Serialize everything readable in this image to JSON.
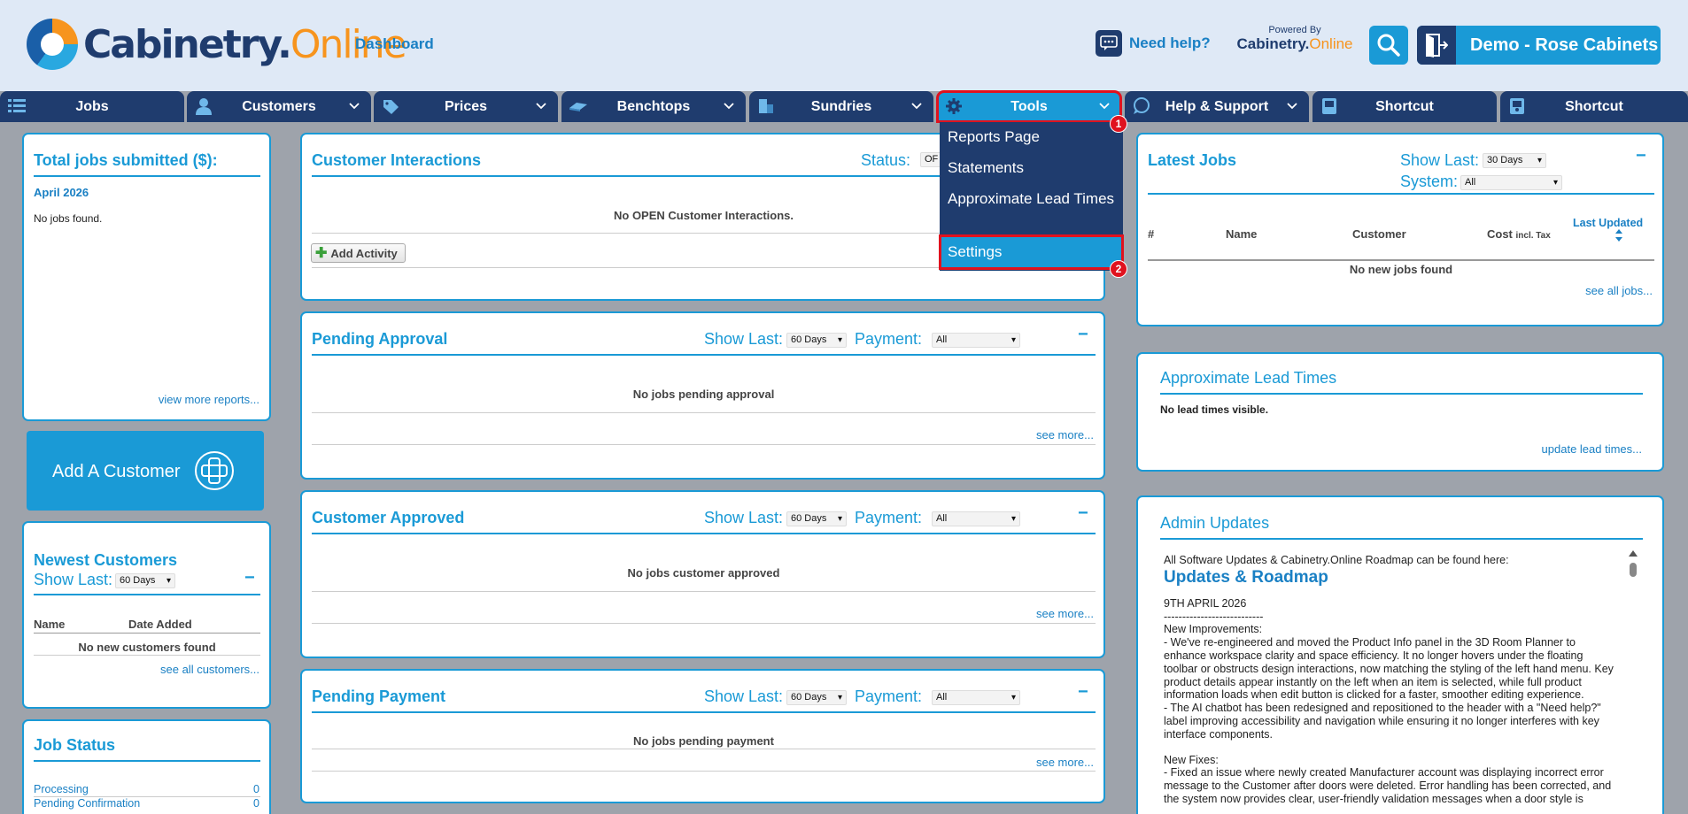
{
  "header": {
    "logo_main": "Cabinetry.",
    "logo_accent": "Online",
    "dashboard_link": "Dashboard",
    "help_label": "Need help?",
    "powered_by_label": "Powered By",
    "powered_logo_main": "Cabinetry.",
    "powered_logo_accent": "Online",
    "user_label": "Demo - Rose Cabinets"
  },
  "nav": {
    "tabs": [
      {
        "label": "Jobs",
        "icon": "list-icon"
      },
      {
        "label": "Customers",
        "icon": "person-icon"
      },
      {
        "label": "Prices",
        "icon": "price-tag-icon"
      },
      {
        "label": "Benchtops",
        "icon": "benchtop-icon"
      },
      {
        "label": "Sundries",
        "icon": "sundries-icon"
      },
      {
        "label": "Tools",
        "icon": "gear-icon"
      },
      {
        "label": "Help & Support",
        "icon": "chat-icon"
      },
      {
        "label": "Shortcut",
        "icon": "shortcut-icon"
      },
      {
        "label": "Shortcut",
        "icon": "shortcut-icon"
      }
    ],
    "tools_menu": [
      "Reports Page",
      "Statements",
      "Approximate Lead Times",
      "Settings"
    ],
    "step_badges": [
      "1",
      "2"
    ]
  },
  "total_jobs": {
    "title": "Total jobs submitted ($):",
    "month": "April 2026",
    "empty": "No jobs found.",
    "more_link": "view more reports..."
  },
  "add_customer": {
    "label": "Add A Customer"
  },
  "newest_customers": {
    "title": "Newest Customers",
    "show_last_label": "Show Last:",
    "show_last_value": "60 Days",
    "col_name": "Name",
    "col_date": "Date Added",
    "empty": "No new customers found",
    "more_link": "see all customers..."
  },
  "job_status": {
    "title": "Job Status",
    "rows": [
      {
        "label": "Processing",
        "count": "0"
      },
      {
        "label": "Pending Confirmation",
        "count": "0"
      }
    ]
  },
  "customer_interactions": {
    "title": "Customer Interactions",
    "status_label": "Status:",
    "status_value": "OF",
    "empty": "No OPEN Customer Interactions.",
    "add_button": "Add Activity"
  },
  "pending_approval": {
    "title": "Pending Approval",
    "show_last_label": "Show Last:",
    "show_last_value": "60 Days",
    "payment_label": "Payment:",
    "payment_value": "All",
    "empty": "No jobs pending approval",
    "more_link": "see more..."
  },
  "customer_approved": {
    "title": "Customer Approved",
    "show_last_label": "Show Last:",
    "show_last_value": "60 Days",
    "payment_label": "Payment:",
    "payment_value": "All",
    "empty": "No jobs customer approved",
    "more_link": "see more..."
  },
  "pending_payment": {
    "title": "Pending Payment",
    "show_last_label": "Show Last:",
    "show_last_value": "60 Days",
    "payment_label": "Payment:",
    "payment_value": "All",
    "empty": "No jobs pending payment",
    "more_link": "see more..."
  },
  "latest_jobs": {
    "title": "Latest Jobs",
    "show_last_label": "Show Last:",
    "show_last_value": "30 Days",
    "system_label": "System:",
    "system_value": "All",
    "col_hash": "#",
    "col_name": "Name",
    "col_customer": "Customer",
    "col_cost": "Cost",
    "col_cost_sub": "incl. Tax",
    "col_updated": "Last Updated",
    "empty": "No new jobs found",
    "more_link": "see all jobs..."
  },
  "lead_times": {
    "title": "Approximate Lead Times",
    "empty": "No lead times visible.",
    "more_link": "update lead times..."
  },
  "admin_updates": {
    "title": "Admin Updates",
    "intro": "All Software Updates & Cabinetry.Online Roadmap can be found here:",
    "roadmap_link": "Updates & Roadmap",
    "date": "9TH APRIL 2026",
    "divider": "---------------------------",
    "improvements_head": "New Improvements:",
    "improvement_1": "- We've re-engineered and moved the Product Info panel in the 3D Room Planner to enhance workspace clarity and space efficiency. It no longer hovers under the floating toolbar or obstructs design interactions, now matching the styling of the left hand menu. Key product details appear instantly on the left when an item is selected, while full product information loads when edit button is clicked for a faster, smoother editing experience.",
    "improvement_2": "- The AI chatbot has been redesigned and repositioned to the header with a \"Need help?\" label improving accessibility and navigation while ensuring it no longer interferes with key interface components.",
    "fixes_head": "New Fixes:",
    "fix_1": "- Fixed an issue where newly created Manufacturer account was displaying incorrect error message to the Customer after doors were deleted. Error handling has been corrected, and the system now provides clear, user-friendly validation messages when a door style is"
  }
}
